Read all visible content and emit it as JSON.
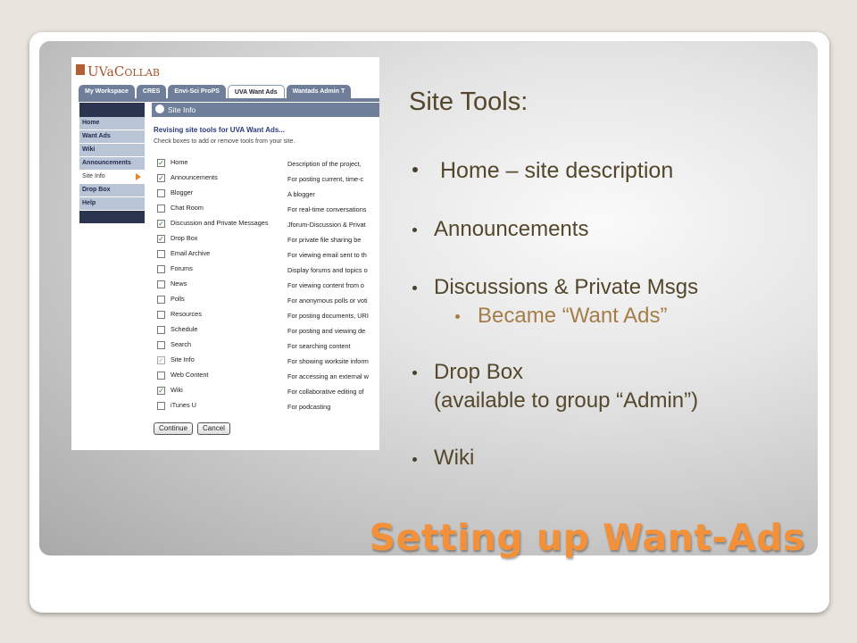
{
  "slide": {
    "title": "Setting up Want-Ads",
    "heading": "Site Tools:",
    "bullets": [
      "Home – site description",
      "Announcements",
      "Discussions & Private Msgs",
      "Became “Want Ads”",
      "Drop Box",
      "(available to group “Admin”)",
      "Wiki"
    ],
    "colors": {
      "title": "#f3913a",
      "body": "#54472b",
      "sub_bullet": "#a47d48"
    }
  },
  "screenshot": {
    "logo": {
      "u": "U",
      "va": "Va",
      "c": "C",
      "ollab": "OLLAB"
    },
    "tabs": [
      "My Workspace",
      "CRES",
      "Envi-Sci ProPS",
      "UVA Want Ads",
      "Wantads Admin T"
    ],
    "sidebar": [
      "Home",
      "Want Ads",
      "Wiki",
      "Announcements",
      "Site Info",
      "Drop Box",
      "Help"
    ],
    "header": "Site Info",
    "revising": "Revising site tools for UVA Want Ads...",
    "instructions": "Check boxes to add or remove tools from your site.",
    "tools": [
      {
        "name": "Home",
        "desc": "Description of the project, ",
        "checked": true
      },
      {
        "name": "Announcements",
        "desc": "For posting current, time-c",
        "checked": true
      },
      {
        "name": "Blogger",
        "desc": "A blogger",
        "checked": false
      },
      {
        "name": "Chat Room",
        "desc": "For real-time conversations",
        "checked": false
      },
      {
        "name": "Discussion and Private Messages",
        "desc": "Jforum-Discussion & Privat",
        "checked": true
      },
      {
        "name": "Drop Box",
        "desc": "For private file sharing be",
        "checked": true
      },
      {
        "name": "Email Archive",
        "desc": "For viewing email sent to th",
        "checked": false
      },
      {
        "name": "Forums",
        "desc": "Display forums and topics o",
        "checked": false
      },
      {
        "name": "News",
        "desc": "For viewing content from o",
        "checked": false
      },
      {
        "name": "Polls",
        "desc": "For anonymous polls or voti",
        "checked": false
      },
      {
        "name": "Resources",
        "desc": "For posting documents, URI",
        "checked": false
      },
      {
        "name": "Schedule",
        "desc": "For posting and viewing de",
        "checked": false
      },
      {
        "name": "Search",
        "desc": "For searching content",
        "checked": false
      },
      {
        "name": "Site Info",
        "desc": "For showing worksite inform",
        "checked": true
      },
      {
        "name": "Web Content",
        "desc": "For accessing an external w",
        "checked": false
      },
      {
        "name": "Wiki",
        "desc": "For collaborative editing of",
        "checked": true
      },
      {
        "name": "iTunes U",
        "desc": "For podcasting",
        "checked": false
      }
    ],
    "buttons": {
      "continue": "Continue",
      "cancel": "Cancel"
    }
  }
}
